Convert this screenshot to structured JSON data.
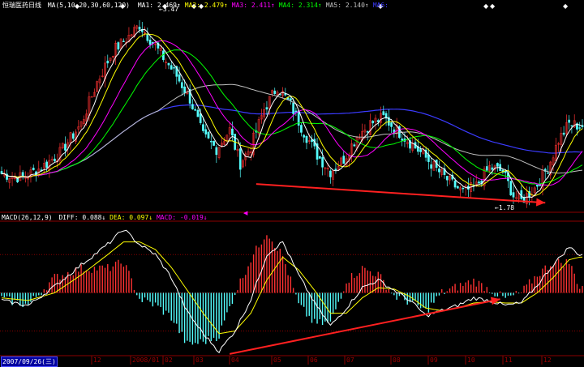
{
  "header": {
    "title": "恒瑞医药日线",
    "ma_label": "MA(5,10,20,30,60,120)",
    "ma_items": [
      {
        "name": "MA1:",
        "value": "2.469",
        "color": "#ffffff"
      },
      {
        "name": "MA2:",
        "value": "2.479",
        "color": "#ffff00"
      },
      {
        "name": "MA3:",
        "value": "2.411",
        "color": "#ff00ff"
      },
      {
        "name": "MA4:",
        "value": "2.314",
        "color": "#00ff00"
      },
      {
        "name": "MA5:",
        "value": "2.140",
        "color": "#c0c0c0"
      },
      {
        "name": "MA6:",
        "value": "",
        "color": "#3b3bff"
      }
    ]
  },
  "macd_header": {
    "label": "MACD(26,12,9)",
    "diff_name": "DIFF:",
    "diff_value": "0.088",
    "dea_name": "DEA:",
    "dea_value": "0.097",
    "macd_name": "MACD:",
    "macd_value": "-0.019"
  },
  "date_axis": {
    "current": "2007/09/26(三)",
    "months": [
      "12",
      "2008/01",
      "02",
      "03",
      "04",
      "05",
      "06",
      "07",
      "08",
      "09",
      "10",
      "11",
      "12"
    ]
  },
  "price_labels": {
    "high": "3.47",
    "low": "1.78"
  },
  "colors": {
    "up": "#ff3232",
    "down": "#54ffff",
    "ma5": "#ffffff",
    "ma10": "#ffff00",
    "ma20": "#ff00ff",
    "ma30": "#00ff00",
    "ma60": "#c0c0c0",
    "ma120": "#3b3bff",
    "grid": "#8b0000",
    "arrow": "#ff2020"
  },
  "chart_data": [
    {
      "type": "candlestick",
      "title": "恒瑞医药日线",
      "x_ticks": [
        "12",
        "2008/01",
        "02",
        "03",
        "04",
        "05",
        "06",
        "07",
        "08",
        "09",
        "10",
        "11",
        "12"
      ],
      "price_extremes": {
        "high": 3.47,
        "low": 1.78
      },
      "ylim": [
        1.7,
        3.6
      ],
      "close_path": [
        [
          0,
          2.04
        ],
        [
          8,
          2.0
        ],
        [
          15,
          2.1
        ],
        [
          22,
          2.24
        ],
        [
          30,
          2.52
        ],
        [
          36,
          2.92
        ],
        [
          42,
          3.22
        ],
        [
          48,
          3.36
        ],
        [
          52,
          3.47
        ],
        [
          57,
          3.3
        ],
        [
          62,
          3.12
        ],
        [
          66,
          2.98
        ],
        [
          71,
          2.76
        ],
        [
          76,
          2.4
        ],
        [
          81,
          2.28
        ],
        [
          86,
          2.46
        ],
        [
          90,
          2.14
        ],
        [
          94,
          2.3
        ],
        [
          99,
          2.66
        ],
        [
          104,
          2.88
        ],
        [
          109,
          2.7
        ],
        [
          114,
          2.44
        ],
        [
          119,
          2.22
        ],
        [
          124,
          2.06
        ],
        [
          129,
          2.18
        ],
        [
          134,
          2.4
        ],
        [
          139,
          2.52
        ],
        [
          144,
          2.58
        ],
        [
          149,
          2.46
        ],
        [
          154,
          2.34
        ],
        [
          159,
          2.22
        ],
        [
          164,
          2.08
        ],
        [
          169,
          1.96
        ],
        [
          174,
          1.86
        ],
        [
          179,
          1.92
        ],
        [
          184,
          2.1
        ],
        [
          189,
          2.06
        ],
        [
          193,
          1.83
        ],
        [
          196,
          1.78
        ],
        [
          201,
          1.9
        ],
        [
          206,
          2.1
        ],
        [
          210,
          2.36
        ],
        [
          214,
          2.52
        ],
        [
          218,
          2.5
        ]
      ],
      "moving_averages": [
        {
          "name": "MA1",
          "last": 2.469
        },
        {
          "name": "MA2",
          "last": 2.479
        },
        {
          "name": "MA3",
          "last": 2.411
        },
        {
          "name": "MA4",
          "last": 2.314
        },
        {
          "name": "MA5",
          "last": 2.14
        }
      ],
      "annotation": "trend line: lower lows"
    },
    {
      "type": "macd",
      "title": "MACD(26,12,9)",
      "diff_last": 0.088,
      "dea_last": 0.097,
      "macd_last": -0.019,
      "ylim": [
        -0.5,
        0.55
      ],
      "diff_path": [
        [
          0,
          -0.06
        ],
        [
          10,
          -0.1
        ],
        [
          20,
          0.05
        ],
        [
          30,
          0.22
        ],
        [
          40,
          0.38
        ],
        [
          46,
          0.5
        ],
        [
          52,
          0.38
        ],
        [
          58,
          0.3
        ],
        [
          64,
          0.12
        ],
        [
          70,
          -0.15
        ],
        [
          76,
          -0.32
        ],
        [
          82,
          -0.46
        ],
        [
          88,
          -0.3
        ],
        [
          94,
          -0.05
        ],
        [
          100,
          0.3
        ],
        [
          106,
          0.4
        ],
        [
          112,
          0.14
        ],
        [
          118,
          -0.08
        ],
        [
          124,
          -0.26
        ],
        [
          130,
          -0.12
        ],
        [
          136,
          0.04
        ],
        [
          142,
          0.1
        ],
        [
          148,
          0.02
        ],
        [
          154,
          -0.06
        ],
        [
          160,
          -0.18
        ],
        [
          166,
          -0.14
        ],
        [
          172,
          -0.1
        ],
        [
          178,
          -0.04
        ],
        [
          184,
          -0.06
        ],
        [
          190,
          -0.1
        ],
        [
          196,
          -0.08
        ],
        [
          202,
          0.06
        ],
        [
          208,
          0.22
        ],
        [
          214,
          0.36
        ],
        [
          218,
          0.3
        ]
      ],
      "dea_path": [
        [
          0,
          -0.04
        ],
        [
          10,
          -0.06
        ],
        [
          20,
          0.0
        ],
        [
          30,
          0.14
        ],
        [
          40,
          0.3
        ],
        [
          46,
          0.4
        ],
        [
          52,
          0.4
        ],
        [
          58,
          0.34
        ],
        [
          64,
          0.2
        ],
        [
          70,
          0.02
        ],
        [
          76,
          -0.16
        ],
        [
          82,
          -0.32
        ],
        [
          88,
          -0.3
        ],
        [
          94,
          -0.16
        ],
        [
          100,
          0.1
        ],
        [
          106,
          0.28
        ],
        [
          112,
          0.18
        ],
        [
          118,
          0.02
        ],
        [
          124,
          -0.16
        ],
        [
          130,
          -0.16
        ],
        [
          136,
          -0.04
        ],
        [
          142,
          0.04
        ],
        [
          148,
          0.03
        ],
        [
          154,
          -0.03
        ],
        [
          160,
          -0.12
        ],
        [
          166,
          -0.14
        ],
        [
          172,
          -0.12
        ],
        [
          178,
          -0.08
        ],
        [
          184,
          -0.07
        ],
        [
          190,
          -0.08
        ],
        [
          196,
          -0.08
        ],
        [
          202,
          0.0
        ],
        [
          208,
          0.12
        ],
        [
          214,
          0.26
        ],
        [
          218,
          0.28
        ]
      ],
      "annotation": "trend line: higher lows (bullish divergence)"
    }
  ]
}
